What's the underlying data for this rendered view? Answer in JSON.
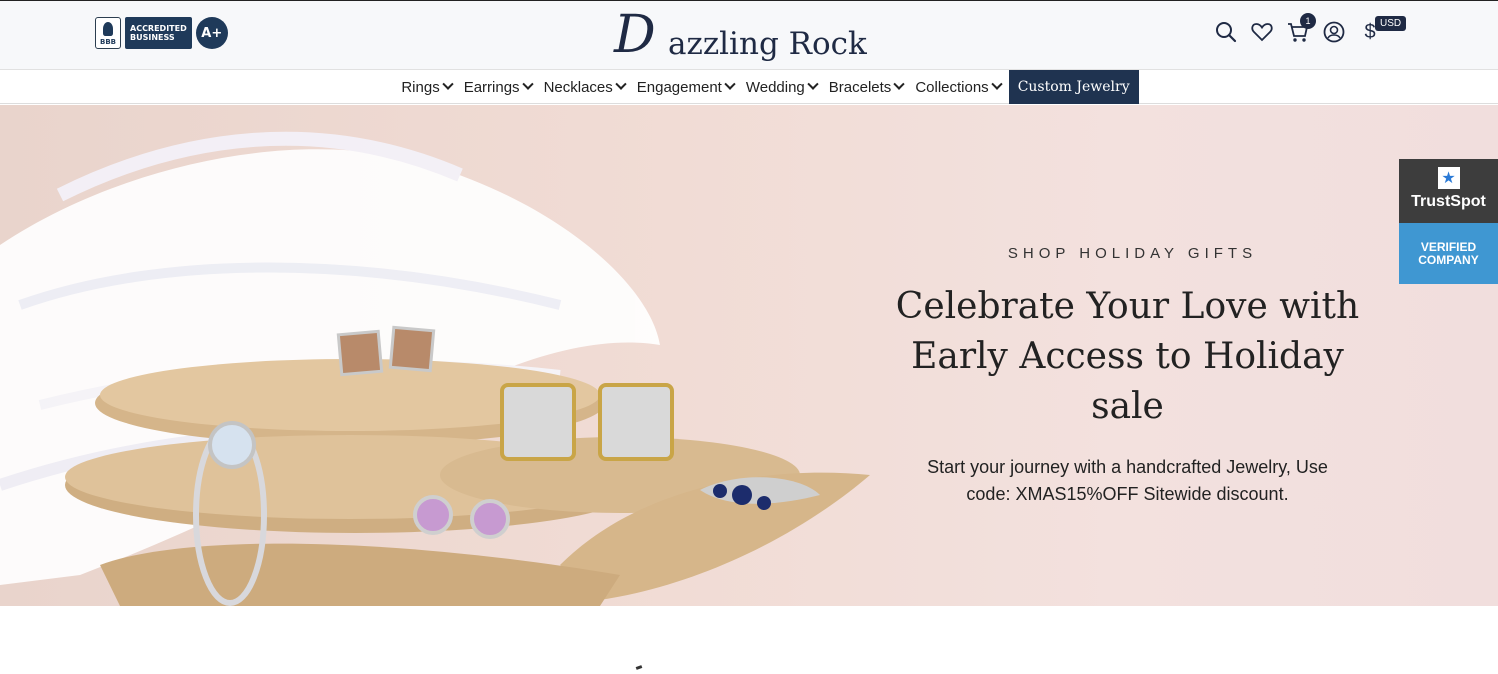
{
  "header": {
    "bbb": {
      "torch_text": "BBB",
      "accredited": [
        "ACCREDITED",
        "BUSINESS"
      ],
      "grade": "A+"
    },
    "logo": {
      "initial": "D",
      "rest": "azzling Rock"
    },
    "icons": [
      "search-icon",
      "heart-icon",
      "cart-icon",
      "user-icon",
      "dollar-icon"
    ],
    "cart_count": "1",
    "currency_symbol": "$",
    "currency": "USD"
  },
  "nav": {
    "items": [
      "Rings",
      "Earrings",
      "Necklaces",
      "Engagement",
      "Wedding",
      "Bracelets",
      "Collections"
    ],
    "custom": "Custom Jewelry"
  },
  "hero": {
    "eyebrow": "SHOP HOLIDAY GIFTS",
    "headline_line1": "Celebrate Your Love with",
    "headline_line2": "Early Access to Holiday sale",
    "subtext_line1": "Start your journey with a handcrafted Jewelry, Use",
    "subtext_line2": "code: XMAS15%OFF Sitewide discount."
  },
  "trustspot": {
    "name": "TrustSpot",
    "badge_line1": "VERIFIED",
    "badge_line2": "COMPANY"
  },
  "colors": {
    "navy": "#1f2a44",
    "custom_bg": "#1f3350",
    "hero_bg": "#f1dcd5",
    "trustspot_dark": "#3d3d3d",
    "trustspot_blue": "#3f97d2"
  }
}
